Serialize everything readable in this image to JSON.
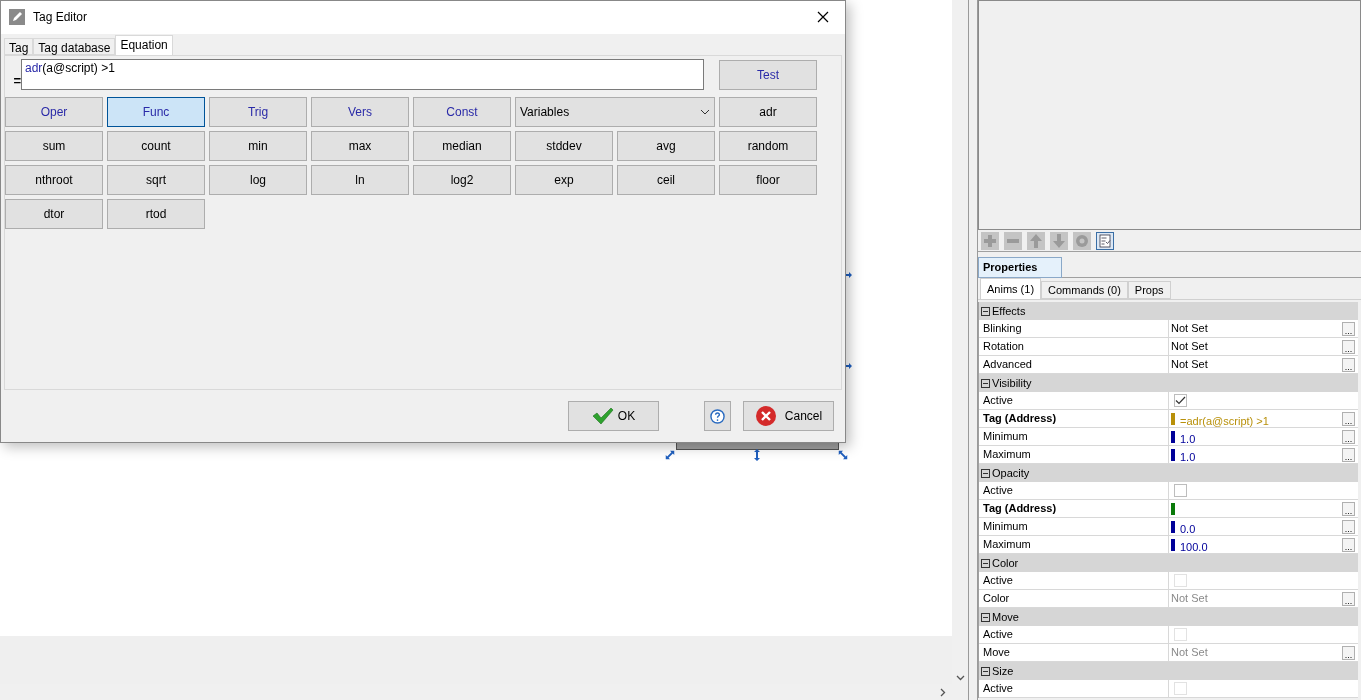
{
  "dialog": {
    "title": "Tag Editor",
    "tabs": [
      {
        "label": "Tag",
        "selected": false
      },
      {
        "label": "Tag database",
        "selected": false
      },
      {
        "label": "Equation",
        "selected": true
      }
    ],
    "equation": {
      "prefix": "=",
      "segments": [
        {
          "kind": "function",
          "text": "adr"
        },
        {
          "kind": "plain",
          "text": "(a@script) >1"
        }
      ]
    },
    "test_button": "Test",
    "button_rows": [
      [
        {
          "label": "Oper",
          "kind": "category",
          "selected": false
        },
        {
          "label": "Func",
          "kind": "category",
          "selected": true
        },
        {
          "label": "Trig",
          "kind": "category",
          "selected": false
        },
        {
          "label": "Vers",
          "kind": "category",
          "selected": false
        },
        {
          "label": "Const",
          "kind": "category",
          "selected": false
        },
        {
          "label": "Variables",
          "kind": "dropdown",
          "selected": false
        },
        {
          "label": "adr",
          "kind": "function",
          "selected": false
        }
      ],
      [
        {
          "label": "sum",
          "kind": "function",
          "selected": false
        },
        {
          "label": "count",
          "kind": "function",
          "selected": false
        },
        {
          "label": "min",
          "kind": "function",
          "selected": false
        },
        {
          "label": "max",
          "kind": "function",
          "selected": false
        },
        {
          "label": "median",
          "kind": "function",
          "selected": false
        },
        {
          "label": "stddev",
          "kind": "function",
          "selected": false
        },
        {
          "label": "avg",
          "kind": "function",
          "selected": false
        },
        {
          "label": "random",
          "kind": "function",
          "selected": false
        }
      ],
      [
        {
          "label": "nthroot",
          "kind": "function",
          "selected": false
        },
        {
          "label": "sqrt",
          "kind": "function",
          "selected": false
        },
        {
          "label": "log",
          "kind": "function",
          "selected": false
        },
        {
          "label": "ln",
          "kind": "function",
          "selected": false
        },
        {
          "label": "log2",
          "kind": "function",
          "selected": false
        },
        {
          "label": "exp",
          "kind": "function",
          "selected": false
        },
        {
          "label": "ceil",
          "kind": "function",
          "selected": false
        },
        {
          "label": "floor",
          "kind": "function",
          "selected": false
        }
      ],
      [
        {
          "label": "dtor",
          "kind": "function",
          "selected": false
        },
        {
          "label": "rtod",
          "kind": "function",
          "selected": false
        }
      ]
    ],
    "ok_button": "OK",
    "cancel_button": "Cancel"
  },
  "properties": {
    "title": "Properties",
    "tabs": [
      {
        "label": "Anims (1)",
        "selected": true
      },
      {
        "label": "Commands (0)",
        "selected": false
      },
      {
        "label": "Props",
        "selected": false
      }
    ],
    "sections": [
      {
        "title": "Effects",
        "expanded": true,
        "rows": [
          {
            "label": "Blinking",
            "kind": "value",
            "value": "Not Set",
            "disabled": false,
            "browse": "..."
          },
          {
            "label": "Rotation",
            "kind": "value",
            "value": "Not Set",
            "disabled": false,
            "browse": "..."
          },
          {
            "label": "Advanced",
            "kind": "value",
            "value": "Not Set",
            "disabled": false,
            "browse": "..."
          }
        ]
      },
      {
        "title": "Visibility",
        "expanded": true,
        "rows": [
          {
            "label": "Active",
            "kind": "checkbox",
            "checked": true,
            "disabled": false
          },
          {
            "label": "Tag (Address)",
            "kind": "address",
            "value": "=adr(a@script) >1",
            "color": "#b8900a",
            "browse": "..."
          },
          {
            "label": "Minimum",
            "kind": "marker",
            "value": "1.0",
            "color": "#000099",
            "browse": "..."
          },
          {
            "label": "Maximum",
            "kind": "marker",
            "value": "1.0",
            "color": "#000099",
            "browse": "..."
          }
        ]
      },
      {
        "title": "Opacity",
        "expanded": true,
        "rows": [
          {
            "label": "Active",
            "kind": "checkbox",
            "checked": false,
            "disabled": false
          },
          {
            "label": "Tag (Address)",
            "kind": "address",
            "color": "#0a7a0a",
            "browse": "..."
          },
          {
            "label": "Minimum",
            "kind": "marker",
            "value": "0.0",
            "color": "#000099",
            "browse": "..."
          },
          {
            "label": "Maximum",
            "kind": "marker",
            "value": "100.0",
            "color": "#000099",
            "browse": "..."
          }
        ]
      },
      {
        "title": "Color",
        "expanded": true,
        "rows": [
          {
            "label": "Active",
            "kind": "checkbox",
            "checked": false,
            "disabled": true
          },
          {
            "label": "Color",
            "kind": "value",
            "value": "Not Set",
            "disabled": true,
            "browse": "..."
          }
        ]
      },
      {
        "title": "Move",
        "expanded": true,
        "rows": [
          {
            "label": "Active",
            "kind": "checkbox",
            "checked": false,
            "disabled": true
          },
          {
            "label": "Move",
            "kind": "value",
            "value": "Not Set",
            "disabled": true,
            "browse": "..."
          }
        ]
      },
      {
        "title": "Size",
        "expanded": true,
        "rows": [
          {
            "label": "Active",
            "kind": "checkbox",
            "checked": false,
            "disabled": true
          }
        ]
      }
    ]
  }
}
